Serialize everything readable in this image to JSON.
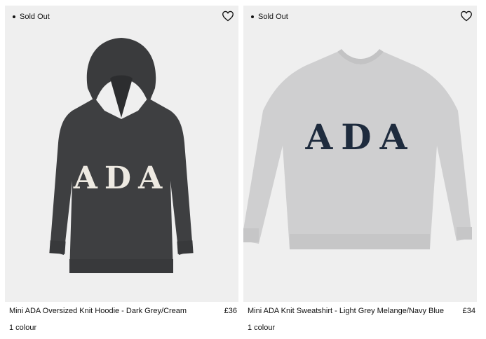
{
  "products": [
    {
      "badge": "Sold Out",
      "name": "Mini ADA Oversized Knit Hoodie - Dark Grey/Cream",
      "price": "£36",
      "colours": "1 colour",
      "print_text": "ADA",
      "garment_color": "#3e3f41",
      "print_color": "#eeeae2",
      "icons": [
        "bullet-dot",
        "heart-outline"
      ]
    },
    {
      "badge": "Sold Out",
      "name": "Mini ADA Knit Sweatshirt - Light Grey Melange/Navy Blue",
      "price": "£34",
      "colours": "1 colour",
      "print_text": "ADA",
      "garment_color": "#cfcfd0",
      "print_color": "#1e2b3d",
      "icons": [
        "bullet-dot",
        "heart-outline"
      ]
    }
  ],
  "colors": {
    "image_background": "#efefef",
    "text": "#111111"
  }
}
